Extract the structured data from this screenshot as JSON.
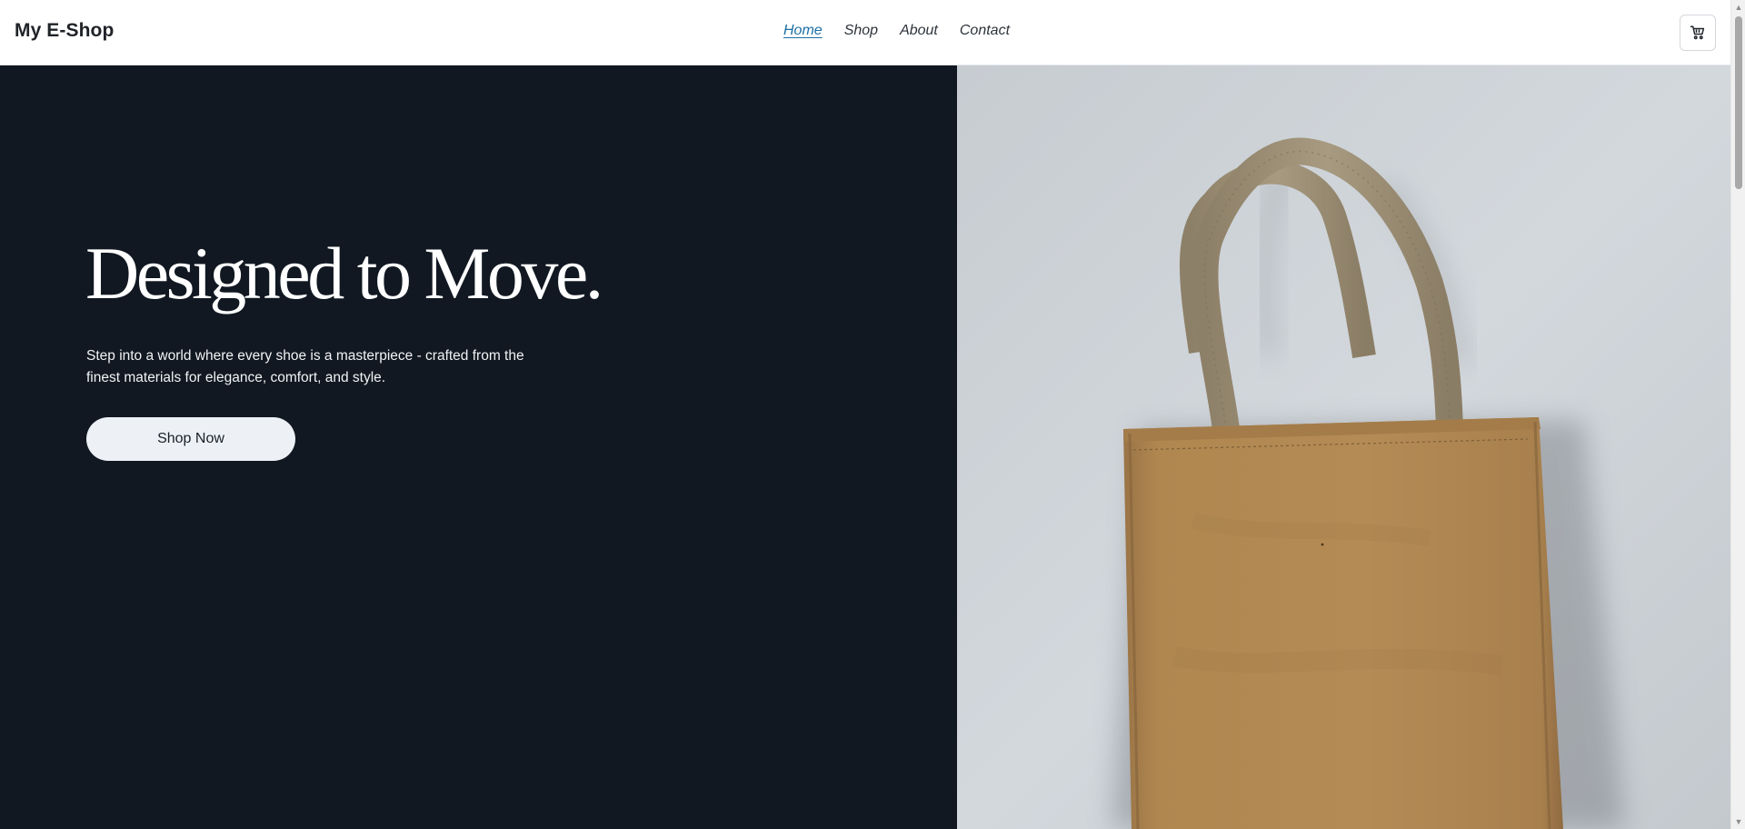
{
  "header": {
    "logo": "My E-Shop",
    "nav": [
      {
        "label": "Home",
        "active": true
      },
      {
        "label": "Shop",
        "active": false
      },
      {
        "label": "About",
        "active": false
      },
      {
        "label": "Contact",
        "active": false
      }
    ],
    "cart_icon": "shopping-cart-icon"
  },
  "hero": {
    "title": "Designed to Move.",
    "subtitle": "Step into a world where every shoe is a masterpiece - crafted from the finest materials for elegance, comfort, and style.",
    "cta_label": "Shop Now",
    "image_subject": "tote-bag-photo"
  },
  "colors": {
    "hero_background": "#111821",
    "active_nav": "#1b6fa6",
    "button_background": "#edf1f5"
  }
}
